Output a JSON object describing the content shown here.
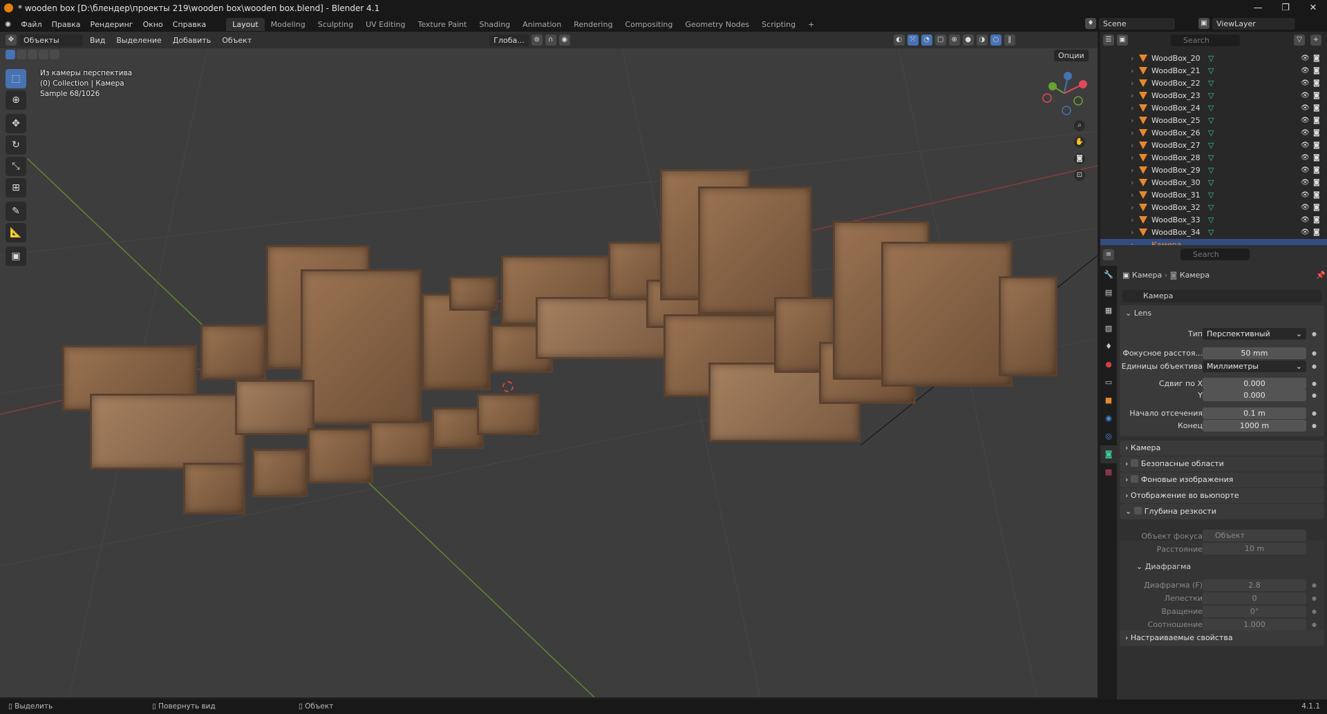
{
  "title": "* wooden box [D:\\блендер\\проекты 219\\wooden box\\wooden box.blend] - Blender 4.1",
  "menus": [
    "Файл",
    "Правка",
    "Рендеринг",
    "Окно",
    "Справка"
  ],
  "workspaces": [
    "Layout",
    "Modeling",
    "Sculpting",
    "UV Editing",
    "Texture Paint",
    "Shading",
    "Animation",
    "Rendering",
    "Compositing",
    "Geometry Nodes",
    "Scripting",
    "+"
  ],
  "scene": "Scene",
  "view_layer": "ViewLayer",
  "header": {
    "mode": "Объекты",
    "view": "Вид",
    "select": "Выделение",
    "add": "Добавить",
    "object": "Объект",
    "orientation": "Глоба...",
    "options": "Опции"
  },
  "overlay": {
    "line1": "Из камеры перспектива",
    "line2": "(0) Collection | Камера",
    "line3": "Sample 68/1026"
  },
  "outliner": {
    "search_placeholder": "Search",
    "items": [
      "WoodBox_20",
      "WoodBox_21",
      "WoodBox_22",
      "WoodBox_23",
      "WoodBox_24",
      "WoodBox_25",
      "WoodBox_26",
      "WoodBox_27",
      "WoodBox_28",
      "WoodBox_29",
      "WoodBox_30",
      "WoodBox_31",
      "WoodBox_32",
      "WoodBox_33",
      "WoodBox_34"
    ],
    "selected": "Камера"
  },
  "props": {
    "search_placeholder": "Search",
    "breadcrumb": [
      "Камера",
      "Камера"
    ],
    "datablock": "Камера",
    "lens_panel": "Lens",
    "fields": [
      {
        "label": "Тип",
        "value": "Перспективный"
      },
      {
        "label": "Фокусное расстоя...",
        "value": "50 mm"
      },
      {
        "label": "Единицы объектива",
        "value": "Миллиметры"
      },
      {
        "label": "Сдвиг по X",
        "value": "0.000"
      },
      {
        "label": "Y",
        "value": "0.000"
      },
      {
        "label": "Начало отсечения",
        "value": "0.1 m"
      },
      {
        "label": "Конец",
        "value": "1000 m"
      }
    ],
    "panels": [
      "Камера",
      "Безопасные области",
      "Фоновые изображения",
      "Отображение во вьюпорте",
      "Глубина резкости"
    ],
    "dof": [
      {
        "label": "Объект фокуса",
        "value": "Объект"
      },
      {
        "label": "Расстояние",
        "value": "10 m"
      }
    ],
    "aperture_panel": "Диафрагма",
    "aperture": [
      {
        "label": "Диафрагма (F)",
        "value": "2.8"
      },
      {
        "label": "Лепестки",
        "value": "0"
      },
      {
        "label": "Вращение",
        "value": "0°"
      },
      {
        "label": "Соотношение",
        "value": "1.000"
      }
    ],
    "custom_panel": "Настраиваемые свойства"
  },
  "status": {
    "select": "Выделить",
    "rotate": "Повернуть вид",
    "object": "Объект",
    "version": "4.1.1"
  }
}
